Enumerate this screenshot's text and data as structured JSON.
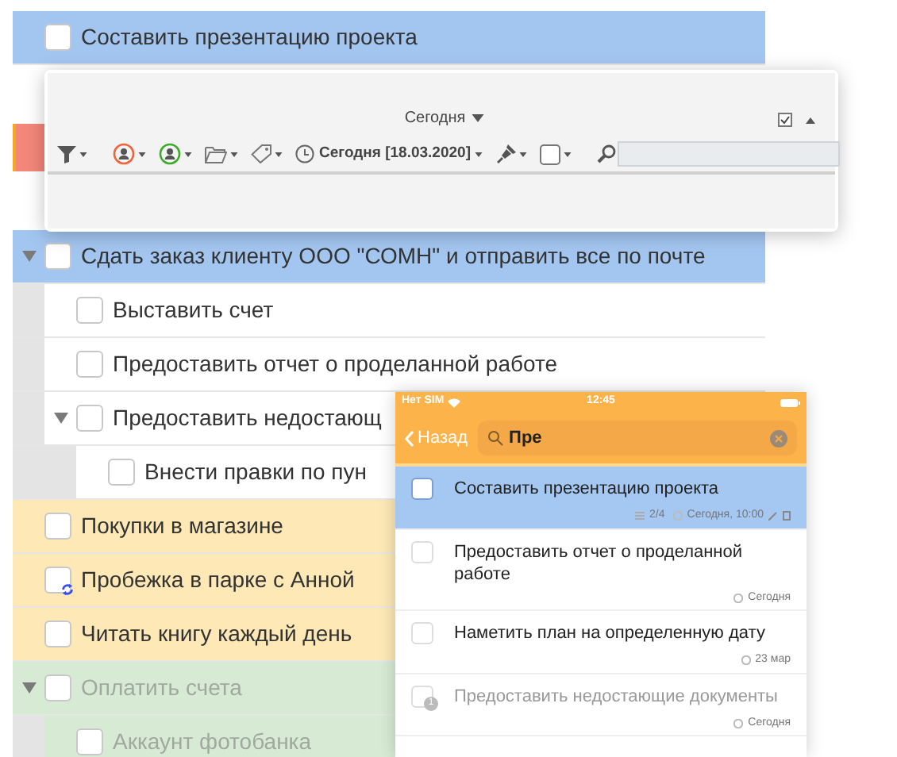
{
  "task_list": {
    "items": [
      {
        "text": "Составить презентацию проекта",
        "color": "#a3c6f1",
        "checked": false,
        "dimmed": false,
        "recurring": false
      },
      {
        "text": "Сдать заказ клиенту ООО \"СОМН\" и отправить все по почте",
        "color": "#a3c6f1",
        "checked": false,
        "dimmed": false,
        "recurring": false,
        "expanded": true,
        "children": [
          {
            "text": "Выставить счет",
            "color": "#ffffff",
            "checked": false,
            "dimmed": false,
            "recurring": false
          },
          {
            "text": "Предоставить отчет о проделанной работе",
            "color": "#ffffff",
            "checked": false,
            "dimmed": false,
            "recurring": false
          },
          {
            "text": "Предоставить недостающ",
            "color": "#ffffff",
            "checked": false,
            "dimmed": false,
            "recurring": false,
            "expanded": true,
            "children": [
              {
                "text": "Внести правки по пун",
                "color": "#ffffff",
                "checked": false,
                "dimmed": false,
                "recurring": false
              }
            ]
          }
        ]
      },
      {
        "text": "Покупки в магазине",
        "color": "#fde8b6",
        "checked": false,
        "dimmed": false,
        "recurring": false
      },
      {
        "text": "Пробежка в парке с Анной",
        "color": "#fde8b6",
        "checked": false,
        "dimmed": false,
        "recurring": true
      },
      {
        "text": "Читать книгу каждый день",
        "color": "#fde8b6",
        "checked": false,
        "dimmed": false,
        "recurring": false
      },
      {
        "text": "Оплатить счета",
        "color": "#d7ebd4",
        "checked": false,
        "dimmed": true,
        "recurring": false,
        "expanded": true,
        "children": [
          {
            "text": "Аккаунт фотобанка",
            "color": "#d7ebd4",
            "checked": false,
            "dimmed": true,
            "recurring": false
          }
        ]
      }
    ]
  },
  "filter_panel": {
    "view": "Сегодня",
    "date_filter": "Сегодня [18.03.2020]"
  },
  "phone": {
    "carrier": "Нет SIM",
    "time": "12:45",
    "back": "Назад",
    "search": {
      "value": "Пре"
    },
    "items": [
      {
        "text": "Составить презентацию проекта",
        "selected": true,
        "dimmed": false,
        "subtasks": "2/4",
        "date": "Сегодня, 10:00",
        "has_note": true,
        "has_attachment": true
      },
      {
        "text": "Предоставить отчет о проделанной работе",
        "selected": false,
        "dimmed": false,
        "date": "Сегодня",
        "has_note": false,
        "has_attachment": false
      },
      {
        "text": "Наметить план на определенную дату",
        "selected": false,
        "dimmed": false,
        "date": "23 мар",
        "has_note": false,
        "has_attachment": false
      },
      {
        "text": "Предоставить недостающие документы",
        "selected": false,
        "dimmed": true,
        "badge": "1",
        "date": "Сегодня",
        "has_note": false,
        "has_attachment": false
      }
    ]
  }
}
